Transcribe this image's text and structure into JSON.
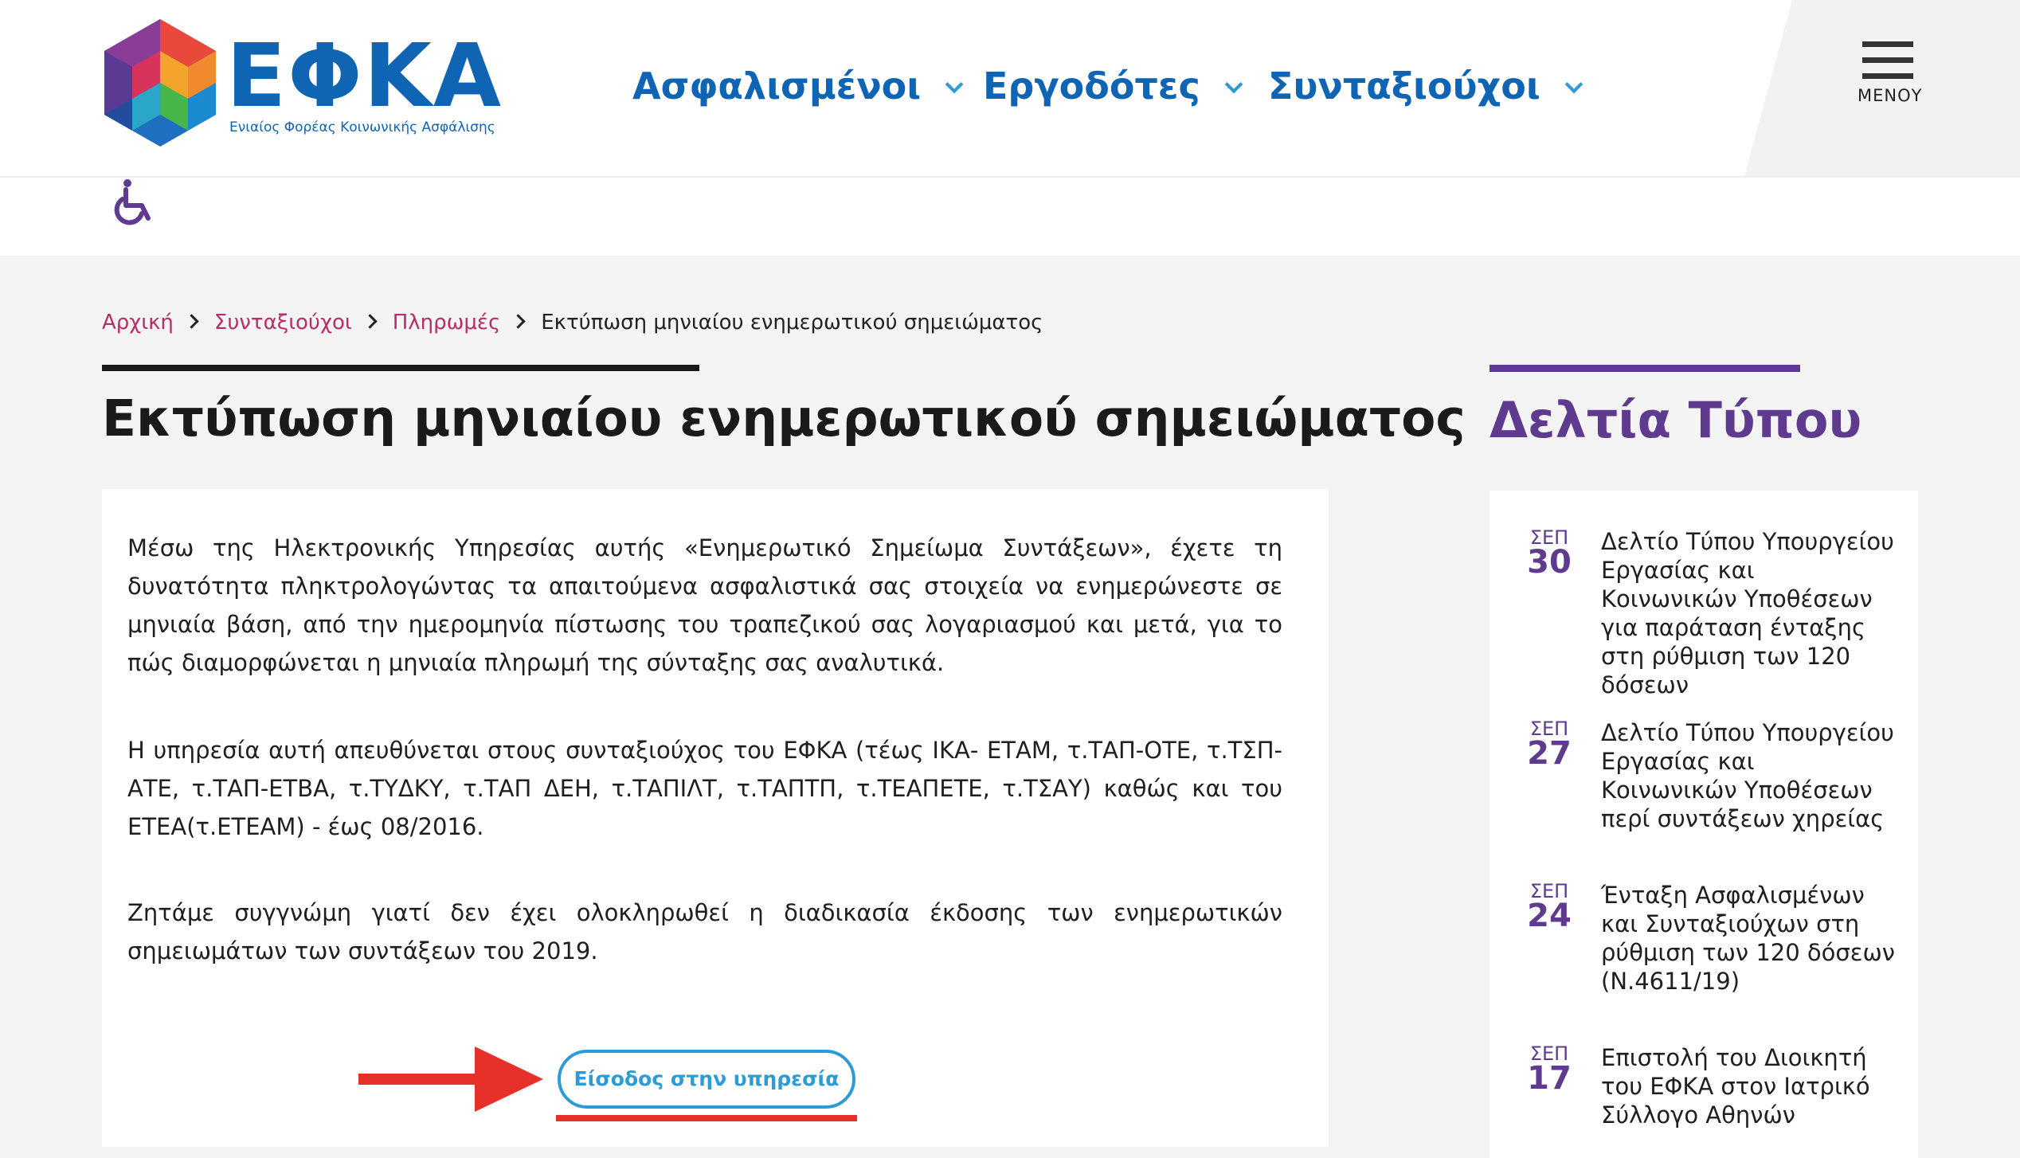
{
  "header": {
    "logo_text": "ΕΦΚΑ",
    "logo_subtitle": "Ενιαίος Φορέας Κοινωνικής Ασφάλισης",
    "nav": [
      {
        "label": "Ασφαλισμένοι"
      },
      {
        "label": "Εργοδότες"
      },
      {
        "label": "Συνταξιούχοι"
      }
    ],
    "menu_label": "ΜΕΝΟΥ"
  },
  "breadcrumb": {
    "items": [
      "Αρχική",
      "Συνταξιούχοι",
      "Πληρωμές"
    ],
    "current": "Εκτύπωση μηνιαίου ενημερωτικού σημειώματος"
  },
  "main": {
    "title": "Εκτύπωση μηνιαίου ενημερωτικού σημειώματος",
    "paragraphs": [
      "Μέσω της Ηλεκτρονικής Υπηρεσίας αυτής «Ενημερωτικό Σημείωμα Συντάξεων», έχετε τη δυνατότητα πληκτρολογώντας τα απαιτούμενα ασφαλιστικά σας στοιχεία να ενημερώνεστε σε μηνιαία βάση, από την ημερομηνία πίστωσης του τραπεζικού σας λογαριασμού και μετά, για το πώς διαμορφώνεται η μηνιαία πληρωμή της σύνταξης σας αναλυτικά.",
      "Η υπηρεσία αυτή απευθύνεται στους συνταξιούχος του ΕΦΚΑ (τέως ΙΚΑ- ΕΤΑΜ, τ.ΤΑΠ-ΟΤΕ, τ.ΤΣΠ-ΑΤΕ, τ.ΤΑΠ-ΕΤΒΑ, τ.ΤΥΔΚΥ, τ.ΤΑΠ ΔΕΗ, τ.ΤΑΠΙΛΤ, τ.ΤΑΠΤΠ, τ.ΤΕΑΠΕΤΕ, τ.ΤΣΑΥ) καθώς και του ΕΤΕΑ(τ.ΕΤΕΑΜ) - έως 08/2016.",
      "Ζητάμε συγγνώμη γιατί δεν έχει ολοκληρωθεί η διαδικασία έκδοσης των ενημερωτικών σημειωμάτων των συντάξεων του 2019."
    ],
    "enter_button": "Είσοδος στην υπηρεσία"
  },
  "sidebar": {
    "title": "Δελτία Τύπου",
    "news": [
      {
        "month": "ΣΕΠ",
        "day": "30",
        "text": "Δελτίο Τύπου Υπουργείου Εργασίας και Κοινωνικών Υποθέσεων για παράταση ένταξης στη ρύθμιση των 120 δόσεων"
      },
      {
        "month": "ΣΕΠ",
        "day": "27",
        "text": "Δελτίο Τύπου Υπουργείου Εργασίας και Κοινωνικών Υποθέσεων περί συντάξεων χηρείας"
      },
      {
        "month": "ΣΕΠ",
        "day": "24",
        "text": "Ένταξη Ασφαλισμένων και Συνταξιούχων στη ρύθμιση των 120 δόσεων (Ν.4611/19)"
      },
      {
        "month": "ΣΕΠ",
        "day": "17",
        "text": "Επιστολή του Διοικητή του ΕΦΚΑ στον Ιατρικό Σύλλογο Αθηνών"
      }
    ]
  },
  "icons": {
    "accessibility": "wheelchair-icon",
    "menu": "hamburger-icon",
    "nav_dropdown": "chevron-down-icon",
    "breadcrumb_separator": "chevron-right-icon",
    "annotation_arrow": "arrow-right-icon"
  },
  "colors": {
    "brand_blue": "#0f64b3",
    "accent_blue": "#2d9bd6",
    "purple": "#5f3b8f",
    "breadcrumb_link": "#b62d6a",
    "annotation_red": "#e5312a"
  }
}
